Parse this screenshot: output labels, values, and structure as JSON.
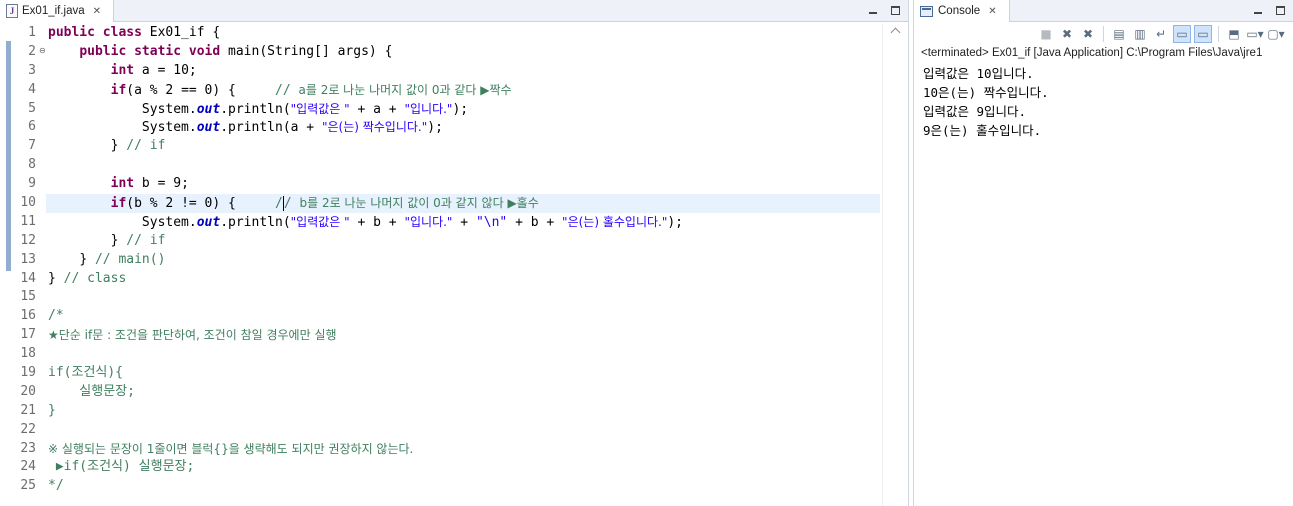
{
  "editor": {
    "tab_label": "Ex01_if.java",
    "tab_icon": "java-file-icon",
    "line_numbers": [
      "1",
      "2",
      "3",
      "4",
      "5",
      "6",
      "7",
      "8",
      "9",
      "10",
      "11",
      "12",
      "13",
      "14",
      "15",
      "16",
      "17",
      "18",
      "19",
      "20",
      "21",
      "22",
      "23",
      "24",
      "25"
    ],
    "current_line": 10,
    "lines": {
      "l1_kw": "public class",
      "l1_rest": " Ex01_if {",
      "l2_kw": "public static void",
      "l2_rest": " main(String[] args) {",
      "l3_kw": "int",
      "l3_rest": " a = 10;",
      "l4_kw": "if",
      "l4_rest": "(a % 2 == 0) {     ",
      "l4_cm1": "// ",
      "l4_cm2": "a를 2로 나눈 나머지 값이 0과 같다 ▶짝수",
      "l5_pre": "System.",
      "l5_out": "out",
      "l5_mid": ".println(",
      "l5_s1": "\"입력값은 \"",
      "l5_plus": " + a + ",
      "l5_s2": "\"입니다.\"",
      "l5_end": ");",
      "l6_pre": "System.",
      "l6_out": "out",
      "l6_mid": ".println(a + ",
      "l6_s1": "\"은(는) 짝수입니다.\"",
      "l6_end": ");",
      "l7_brace": "} ",
      "l7_cm": "// if",
      "l9_kw": "int",
      "l9_rest": " b = 9;",
      "l10_kw": "if",
      "l10_rest": "(b % 2 != 0) {     ",
      "l10_cm1": "/",
      "l10_cm2": "/ ",
      "l10_cm3": "b를 2로 나눈 나머지 값이 0과 같지 않다 ▶홀수",
      "l11_pre": "System.",
      "l11_out": "out",
      "l11_mid": ".println(",
      "l11_s1": "\"입력값은 \"",
      "l11_p1": " + b + ",
      "l11_s2": "\"입니다.\"",
      "l11_p2": " + ",
      "l11_s3": "\"\\n\"",
      "l11_p3": " + b + ",
      "l11_s4": "\"은(는) 홀수입니다.\"",
      "l11_end": ");",
      "l12_brace": "} ",
      "l12_cm": "// if",
      "l13_brace": "} ",
      "l13_cm": "// main()",
      "l14_brace": "} ",
      "l14_cm": "// class",
      "l16_cm": "/*",
      "l17_cm": "★단순 if문 : 조건을 판단하여, 조건이 참일 경우에만 실행",
      "l19_cm": "if(조건식){",
      "l20_cm": "    실행문장;",
      "l21_cm": "}",
      "l23_cm": "※ 실행되는 문장이 1줄이면 블럭{}을 생략해도 되지만 권장하지 않는다.",
      "l24_cm": " ▶if(조건식) 실행문장;",
      "l25_cm": "*/"
    }
  },
  "console": {
    "tab_label": "Console",
    "header": "<terminated> Ex01_if [Java Application] C:\\Program Files\\Java\\jre1",
    "output": [
      "입력값은 10입니다.",
      "10은(는) 짝수입니다.",
      "입력값은 9입니다.",
      "9은(는) 홀수입니다."
    ],
    "toolbar_icons": [
      "terminate-icon",
      "remove-launch-icon",
      "remove-all-terminated-icon",
      "clear-console-icon",
      "scroll-lock-icon",
      "word-wrap-icon",
      "show-on-stdout-icon",
      "show-on-stderr-icon",
      "pin-console-icon",
      "display-selected-console-icon",
      "open-console-icon"
    ]
  },
  "colors": {
    "keyword": "#7f0055",
    "string": "#2a00ff",
    "comment": "#3f7f5f",
    "static_field": "#0000c0",
    "current_line_bg": "#e8f2fe"
  }
}
